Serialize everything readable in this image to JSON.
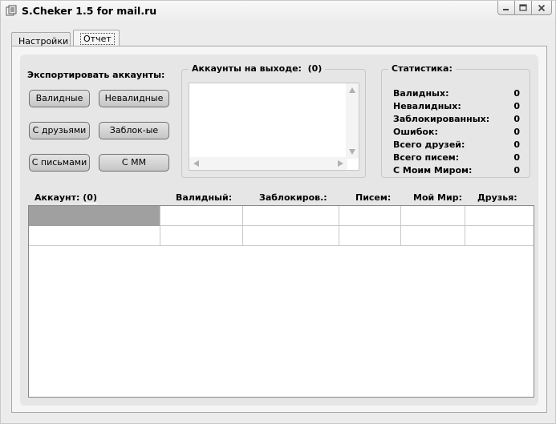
{
  "window": {
    "title": "S.Cheker 1.5 for mail.ru"
  },
  "tabs": [
    {
      "label": "Настройки"
    },
    {
      "label": "Отчет"
    }
  ],
  "export": {
    "heading": "Экспортировать аккаунты:",
    "buttons": [
      "Валидные",
      "Невалидные",
      "С друзьями",
      "Заблок-ые",
      "С письмами",
      "С ММ"
    ]
  },
  "output": {
    "heading": "Аккаунты на выходе:",
    "count": "(0)"
  },
  "stats": {
    "heading": "Статистика:",
    "rows": [
      {
        "label": "Валидных:",
        "value": "0"
      },
      {
        "label": "Невалидных:",
        "value": "0"
      },
      {
        "label": "Заблокированных:",
        "value": "0"
      },
      {
        "label": "Ошибок:",
        "value": "0"
      },
      {
        "label": "Всего друзей:",
        "value": "0"
      },
      {
        "label": "Всего писем:",
        "value": "0"
      },
      {
        "label": "С Моим Миром:",
        "value": "0"
      }
    ]
  },
  "table": {
    "account_label": "Аккаунт:",
    "account_count": "(0)",
    "columns": [
      "Валидный:",
      "Заблокиров.:",
      "Писем:",
      "Мой Мир:",
      "Друзья:"
    ]
  }
}
